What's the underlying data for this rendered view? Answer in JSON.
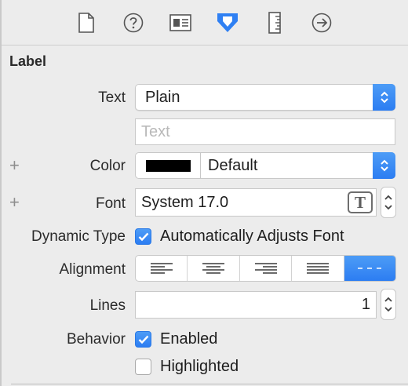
{
  "toolbar": {
    "icons": [
      "file-inspector-icon",
      "quick-help-icon",
      "identity-inspector-icon",
      "attributes-inspector-icon",
      "size-inspector-icon",
      "connections-inspector-icon"
    ],
    "active_icon": "attributes-inspector-icon",
    "accent_color": "#2f80f3"
  },
  "section": {
    "title": "Label"
  },
  "text": {
    "label": "Text",
    "popup_value": "Plain",
    "placeholder": "Text",
    "value": ""
  },
  "color": {
    "label": "Color",
    "swatch_color": "#000000",
    "value": "Default"
  },
  "font": {
    "label": "Font",
    "value": "System 17.0",
    "button_glyph": "T"
  },
  "dynamic_type": {
    "label": "Dynamic Type",
    "checkbox_label": "Automatically Adjusts Font",
    "checked": true
  },
  "alignment": {
    "label": "Alignment",
    "options": [
      "left",
      "center",
      "right",
      "justified",
      "natural"
    ],
    "selected": "natural"
  },
  "lines": {
    "label": "Lines",
    "value": "1"
  },
  "behavior": {
    "label": "Behavior",
    "enabled_label": "Enabled",
    "enabled_checked": true,
    "highlighted_label": "Highlighted",
    "highlighted_checked": false
  }
}
